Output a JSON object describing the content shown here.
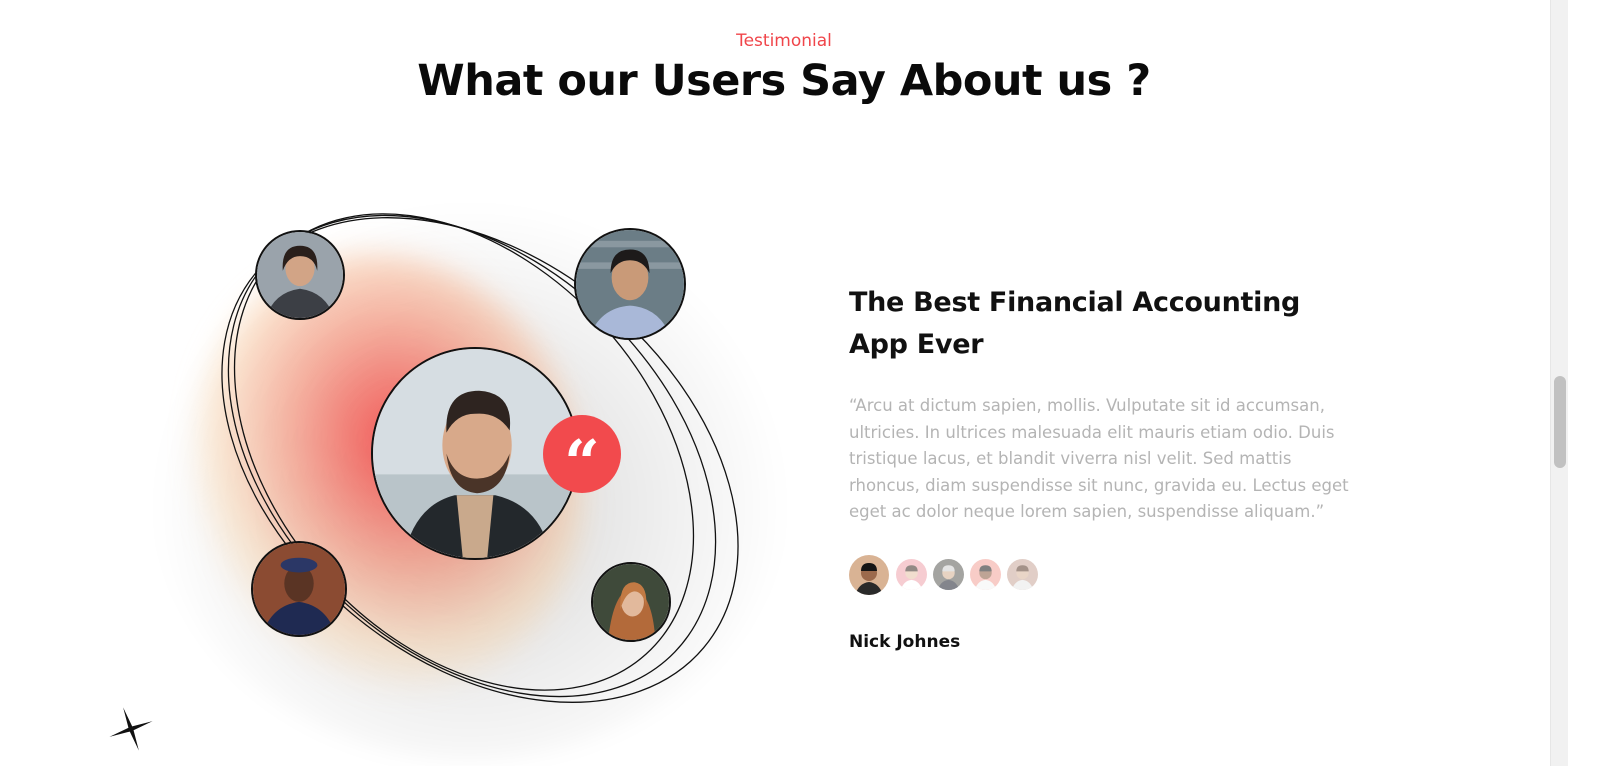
{
  "section": {
    "eyebrow": "Testimonial",
    "heading": "What our Users Say About us ?"
  },
  "testimonial": {
    "title": "The Best Financial Accounting App Ever",
    "quote": "“Arcu at dictum sapien, mollis. Vulputate sit id accumsan, ultricies. In ultrices malesuada elit mauris etiam odio. Duis tristique lacus, et blandit viverra nisl velit. Sed mattis rhoncus, diam suspendisse sit nunc, gravida eu. Lectus eget eget ac dolor neque lorem sapien, suspendisse aliquam.”",
    "author": "Nick Johnes",
    "quote_icon": "“"
  },
  "colors": {
    "accent": "#f24a4d",
    "heading": "#0a0a0a",
    "body_text": "#b4b4b4"
  },
  "icons": [
    "quote-icon",
    "sparkle-icon"
  ],
  "thumbnails": [
    {
      "name": "user-thumb-1",
      "active": true
    },
    {
      "name": "user-thumb-2",
      "active": false
    },
    {
      "name": "user-thumb-3",
      "active": false
    },
    {
      "name": "user-thumb-4",
      "active": false
    },
    {
      "name": "user-thumb-5",
      "active": false
    }
  ]
}
